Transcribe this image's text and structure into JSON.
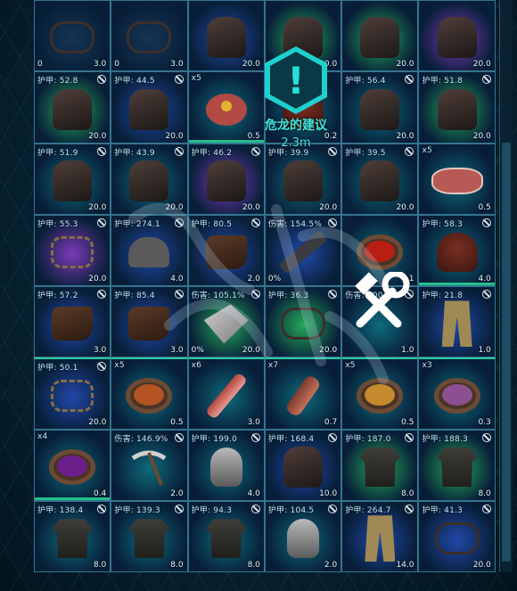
{
  "overlay": {
    "icon": "exclamation-hex-icon",
    "glyph": "!",
    "title": "危龙的建议",
    "distance": "2.3m"
  },
  "colors": {
    "accent": "#27e1de",
    "durability": "#22c08a",
    "border": "#5ab9d7"
  },
  "slots": [
    {
      "stat": "",
      "weight": "3.0",
      "left": "0",
      "icon": "item-icon",
      "glow": "dark",
      "noicon": false
    },
    {
      "stat": "",
      "weight": "3.0",
      "left": "0",
      "icon": "item-icon",
      "glow": "dark",
      "noicon": false
    },
    {
      "stat": "",
      "weight": "20.0",
      "left": "",
      "icon": "gear-icon",
      "glow": "blue",
      "noicon": false
    },
    {
      "stat": "",
      "weight": "20.0",
      "left": "",
      "icon": "gear-icon",
      "glow": "green",
      "noicon": false
    },
    {
      "stat": "",
      "weight": "20.0",
      "left": "",
      "icon": "gear-icon",
      "glow": "green",
      "noicon": false
    },
    {
      "stat": "",
      "weight": "20.0",
      "left": "",
      "icon": "gear-icon",
      "glow": "purple",
      "noicon": false
    },
    {
      "stat": "护甲: 52.8",
      "weight": "20.0",
      "left": "",
      "icon": "gauntlet-icon",
      "glow": "green",
      "noicon": true
    },
    {
      "stat": "护甲: 44.5",
      "weight": "20.0",
      "left": "",
      "icon": "gauntlet-icon",
      "glow": "blue",
      "noicon": true
    },
    {
      "stat": "x5",
      "weight": "0.5",
      "left": "",
      "icon": "cooked-meat-icon",
      "glow": "teal",
      "noicon": false,
      "bar": 100
    },
    {
      "stat": "x2",
      "weight": "0.2",
      "left": "",
      "icon": "kibble-icon",
      "glow": "teal",
      "noicon": false
    },
    {
      "stat": "护甲: 56.4",
      "weight": "20.0",
      "left": "",
      "icon": "gauntlet-icon",
      "glow": "teal",
      "noicon": true
    },
    {
      "stat": "护甲: 51.8",
      "weight": "20.0",
      "left": "",
      "icon": "gauntlet-icon",
      "glow": "green",
      "noicon": true
    },
    {
      "stat": "护甲: 51.9",
      "weight": "20.0",
      "left": "",
      "icon": "gauntlet-icon",
      "glow": "teal",
      "noicon": true
    },
    {
      "stat": "护甲: 43.9",
      "weight": "20.0",
      "left": "",
      "icon": "gauntlet-icon",
      "glow": "teal",
      "noicon": true
    },
    {
      "stat": "护甲: 46.2",
      "weight": "20.0",
      "left": "",
      "icon": "gauntlet-icon",
      "glow": "purple",
      "noicon": true
    },
    {
      "stat": "护甲: 39.9",
      "weight": "20.0",
      "left": "",
      "icon": "gauntlet-icon",
      "glow": "teal",
      "noicon": true
    },
    {
      "stat": "护甲: 39.5",
      "weight": "20.0",
      "left": "",
      "icon": "gauntlet-icon",
      "glow": "teal",
      "noicon": true
    },
    {
      "stat": "x5",
      "weight": "0.5",
      "left": "",
      "icon": "raw-meat-icon",
      "glow": "teal",
      "noicon": false
    },
    {
      "stat": "护甲: 55.3",
      "weight": "20.0",
      "left": "",
      "icon": "sandals-icon",
      "glow": "purple",
      "noicon": true
    },
    {
      "stat": "护甲: 274.1",
      "weight": "4.0",
      "left": "",
      "icon": "mining-helmet-icon",
      "glow": "blue",
      "noicon": true
    },
    {
      "stat": "护甲: 80.5",
      "weight": "2.0",
      "left": "",
      "icon": "boots-icon",
      "glow": "blue",
      "noicon": true
    },
    {
      "stat": "伤害: 154.5%",
      "weight": "",
      "left": "0%",
      "icon": "rifle-icon",
      "glow": "blue",
      "noicon": true
    },
    {
      "stat": "",
      "weight": "0.1",
      "left": "",
      "icon": "bowl-icon",
      "glow": "teal",
      "noicon": false,
      "fill": "#b81e14"
    },
    {
      "stat": "护甲: 58.3",
      "weight": "4.0",
      "left": "",
      "icon": "hood-icon",
      "glow": "teal",
      "noicon": true,
      "bar": 100
    },
    {
      "stat": "护甲: 57.2",
      "weight": "3.0",
      "left": "",
      "icon": "gloves-icon",
      "glow": "blue",
      "noicon": true
    },
    {
      "stat": "护甲: 85.4",
      "weight": "3.0",
      "left": "",
      "icon": "boots-icon",
      "glow": "blue",
      "noicon": true
    },
    {
      "stat": "伤害: 105.1%",
      "weight": "20.0",
      "left": "0%",
      "icon": "tool-icon",
      "glow": "green",
      "noicon": true
    },
    {
      "stat": "护甲: 36.3",
      "weight": "20.0",
      "left": "",
      "icon": "claw-icon",
      "glow": "green",
      "noicon": true
    },
    {
      "stat": "伤害: 100.0%",
      "weight": "1.0",
      "left": "",
      "icon": "crossed-tools-icon",
      "glow": "teal",
      "noicon": true
    },
    {
      "stat": "护甲: 21.8",
      "weight": "1.0",
      "left": "",
      "icon": "pants-icon",
      "glow": "blue",
      "noicon": true
    },
    {
      "stat": "护甲: 50.1",
      "weight": "20.0",
      "left": "",
      "icon": "sandals-icon",
      "glow": "blue",
      "noicon": true,
      "top": true
    },
    {
      "stat": "x5",
      "weight": "0.5",
      "left": "",
      "icon": "bowl-icon",
      "glow": "teal",
      "noicon": false,
      "fill": "#b35322",
      "top": true
    },
    {
      "stat": "x6",
      "weight": "3.0",
      "left": "",
      "icon": "stick-icon",
      "glow": "teal",
      "noicon": false,
      "top": true
    },
    {
      "stat": "x7",
      "weight": "0.7",
      "left": "",
      "icon": "vial-icon",
      "glow": "teal",
      "noicon": false,
      "top": true
    },
    {
      "stat": "x5",
      "weight": "0.5",
      "left": "",
      "icon": "bowl-icon",
      "glow": "teal",
      "noicon": false,
      "fill": "#c58a2e",
      "top": true
    },
    {
      "stat": "x3",
      "weight": "0.3",
      "left": "",
      "icon": "bowl-icon",
      "glow": "teal",
      "noicon": false,
      "fill": "#8c4f8f",
      "top": true
    },
    {
      "stat": "x4",
      "weight": "0.4",
      "left": "",
      "icon": "bowl-icon",
      "glow": "teal",
      "noicon": false,
      "fill": "#6a1f8a",
      "bar": 100
    },
    {
      "stat": "伤害: 146.9%",
      "weight": "2.0",
      "left": "",
      "icon": "pickaxe-icon",
      "glow": "teal",
      "noicon": true
    },
    {
      "stat": "护甲: 199.0",
      "weight": "4.0",
      "left": "",
      "icon": "helmet-icon",
      "glow": "teal",
      "noicon": true
    },
    {
      "stat": "护甲: 168.4",
      "weight": "10.0",
      "left": "",
      "icon": "chestplate-icon",
      "glow": "blue",
      "noicon": true
    },
    {
      "stat": "护甲: 187.0",
      "weight": "8.0",
      "left": "",
      "icon": "shirt-icon",
      "glow": "green",
      "noicon": true
    },
    {
      "stat": "护甲: 188.3",
      "weight": "8.0",
      "left": "",
      "icon": "shirt-icon",
      "glow": "green",
      "noicon": true
    },
    {
      "stat": "护甲: 138.4",
      "weight": "8.0",
      "left": "",
      "icon": "shirt-icon",
      "glow": "teal",
      "noicon": true
    },
    {
      "stat": "护甲: 139.3",
      "weight": "8.0",
      "left": "",
      "icon": "shirt-icon",
      "glow": "teal",
      "noicon": true
    },
    {
      "stat": "护甲: 94.3",
      "weight": "8.0",
      "left": "",
      "icon": "shirt-icon",
      "glow": "teal",
      "noicon": true
    },
    {
      "stat": "护甲: 104.5",
      "weight": "2.0",
      "left": "",
      "icon": "face-mask-icon",
      "glow": "teal",
      "noicon": true
    },
    {
      "stat": "护甲: 264.7",
      "weight": "14.0",
      "left": "",
      "icon": "leggings-icon",
      "glow": "blue",
      "noicon": true
    },
    {
      "stat": "护甲: 41.3",
      "weight": "20.0",
      "left": "",
      "icon": "claw-icon",
      "glow": "blue",
      "noicon": true
    }
  ]
}
